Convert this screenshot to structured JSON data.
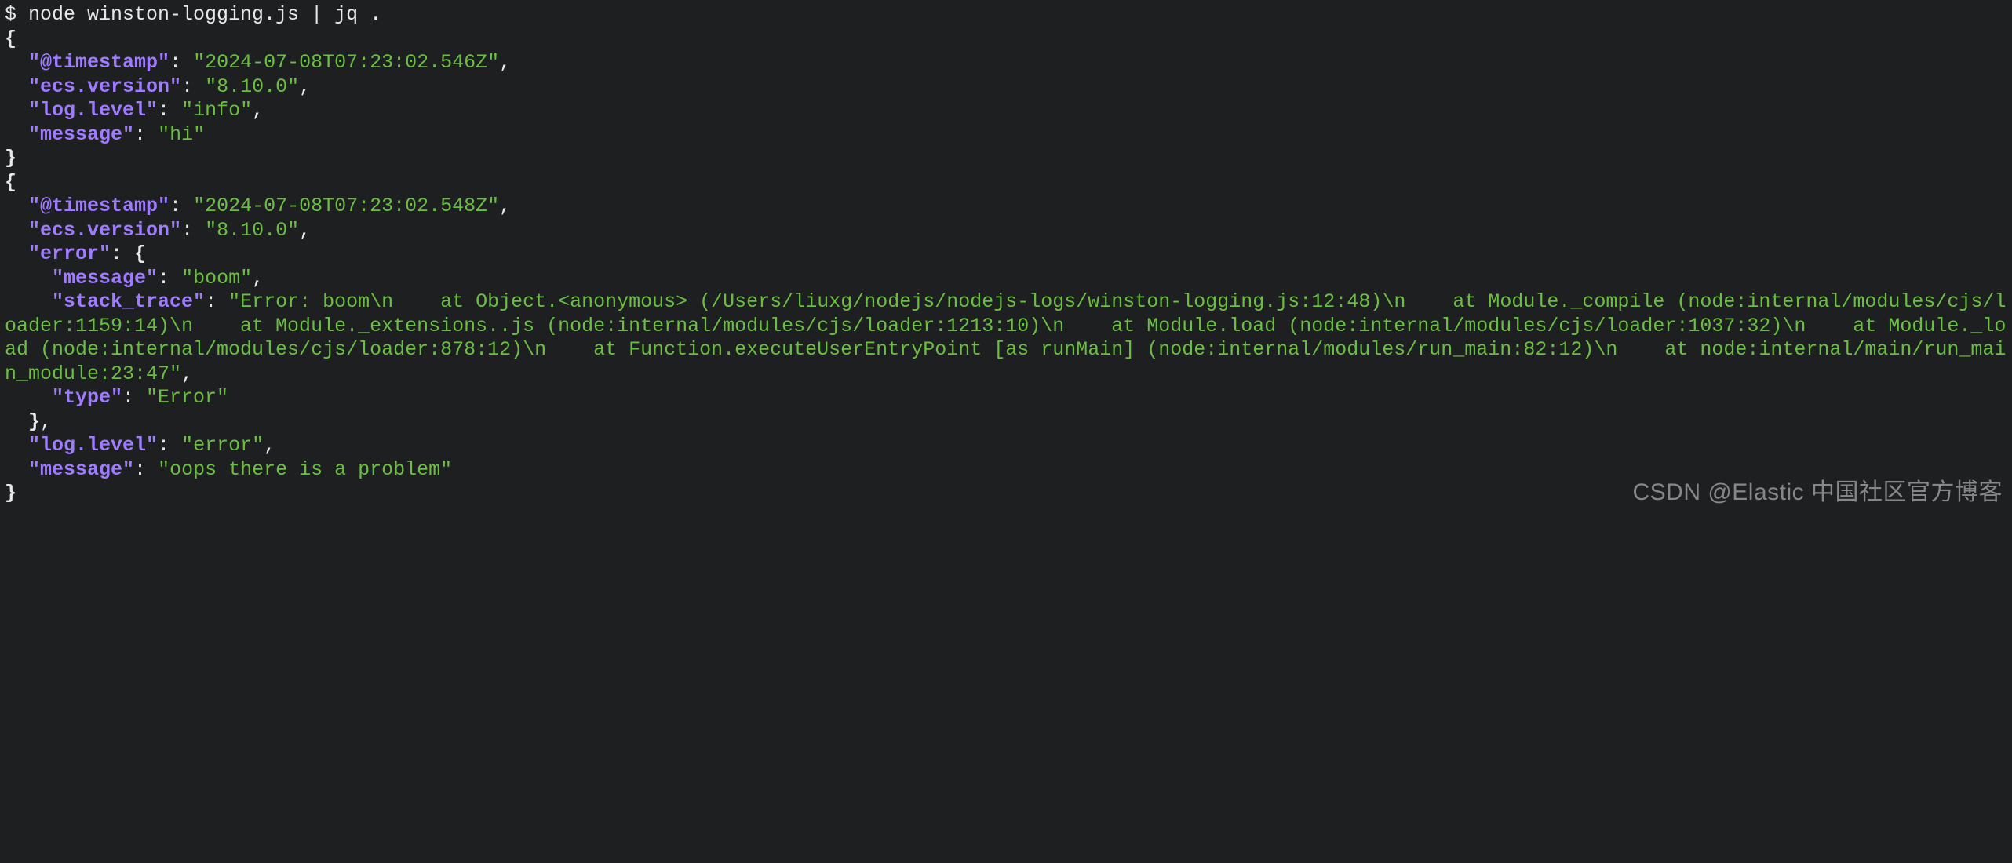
{
  "command_line": "$ node winston-logging.js | jq .",
  "indent": "  ",
  "indent2": "    ",
  "records": [
    {
      "fields": [
        {
          "key": "\"@timestamp\"",
          "value": "\"2024-07-08T07:23:02.546Z\"",
          "comma": ","
        },
        {
          "key": "\"ecs.version\"",
          "value": "\"8.10.0\"",
          "comma": ","
        },
        {
          "key": "\"log.level\"",
          "value": "\"info\"",
          "comma": ","
        },
        {
          "key": "\"message\"",
          "value": "\"hi\"",
          "comma": ""
        }
      ]
    }
  ],
  "record2": {
    "timestamp_key": "\"@timestamp\"",
    "timestamp_val": "\"2024-07-08T07:23:02.548Z\"",
    "ecs_key": "\"ecs.version\"",
    "ecs_val": "\"8.10.0\"",
    "error_key": "\"error\"",
    "err_msg_key": "\"message\"",
    "err_msg_val": "\"boom\"",
    "stack_key": "\"stack_trace\"",
    "stack_val": "\"Error: boom\\n    at Object.<anonymous> (/Users/liuxg/nodejs/nodejs-logs/winston-logging.js:12:48)\\n    at Module._compile (node:internal/modules/cjs/loader:1159:14)\\n    at Module._extensions..js (node:internal/modules/cjs/loader:1213:10)\\n    at Module.load (node:internal/modules/cjs/loader:1037:32)\\n    at Module._load (node:internal/modules/cjs/loader:878:12)\\n    at Function.executeUserEntryPoint [as runMain] (node:internal/modules/run_main:82:12)\\n    at node:internal/main/run_main_module:23:47\"",
    "type_key": "\"type\"",
    "type_val": "\"Error\"",
    "loglevel_key": "\"log.level\"",
    "loglevel_val": "\"error\"",
    "message_key": "\"message\"",
    "message_val": "\"oops there is a problem\""
  },
  "watermark": "CSDN @Elastic 中国社区官方博客"
}
